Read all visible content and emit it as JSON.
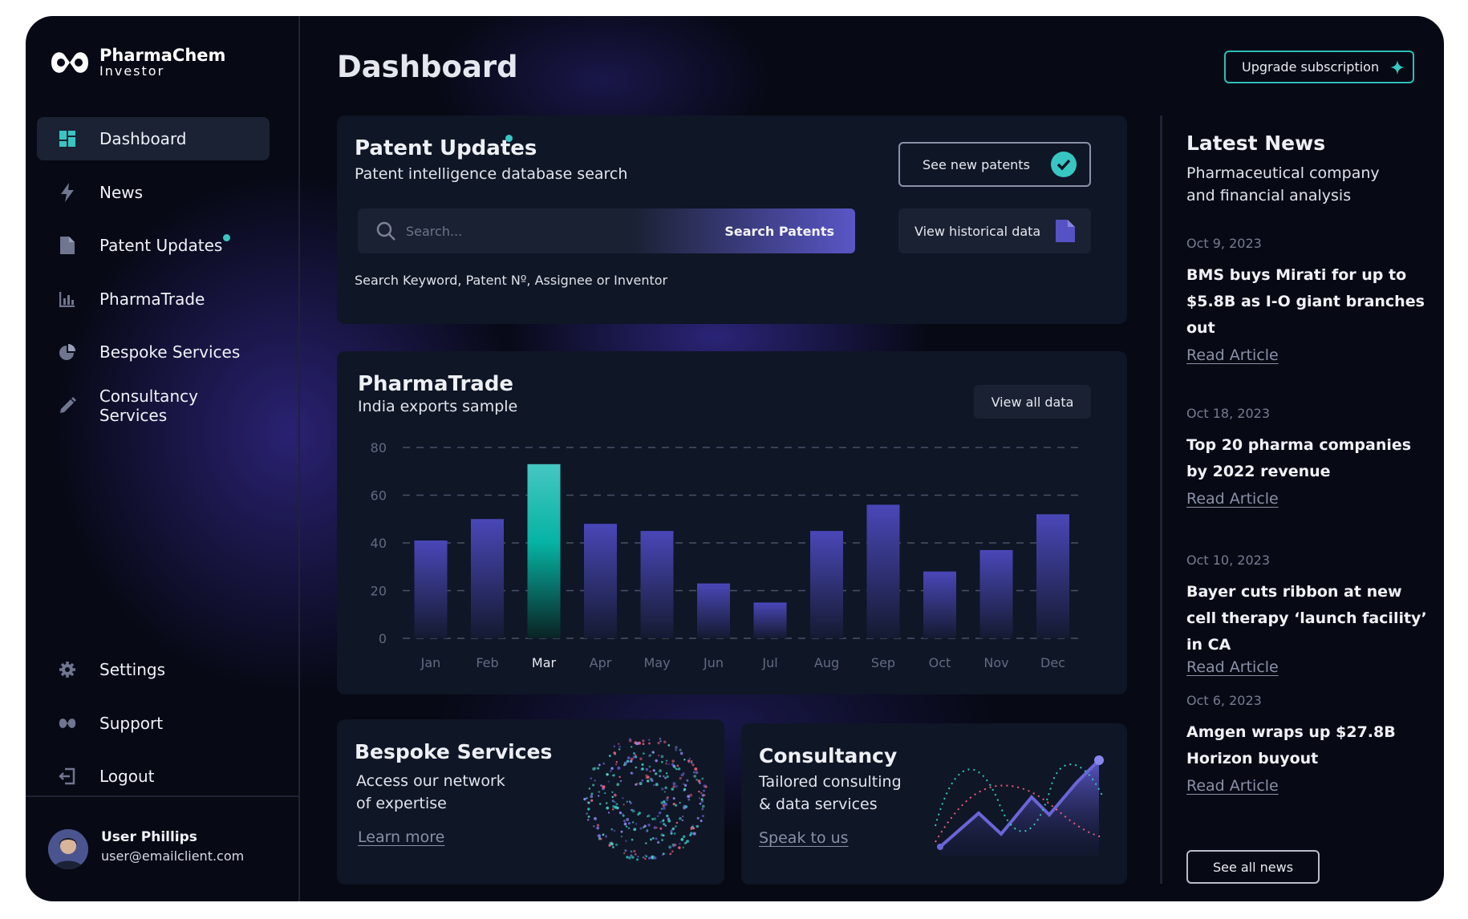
{
  "brand": {
    "name_line1": "PharmaChem",
    "name_line2": "Investor"
  },
  "sidebar": {
    "items": [
      {
        "label": "Dashboard",
        "icon": "dashboard-grid-icon",
        "active": true
      },
      {
        "label": "News",
        "icon": "lightning-icon"
      },
      {
        "label": "Patent Updates",
        "icon": "document-icon",
        "has_dot": true
      },
      {
        "label": "PharmaTrade",
        "icon": "bar-chart-icon"
      },
      {
        "label": "Bespoke Services",
        "icon": "pie-chart-icon"
      },
      {
        "label": "Consultancy Services",
        "icon": "pencil-icon"
      }
    ],
    "bottom_items": [
      {
        "label": "Settings",
        "icon": "gear-icon"
      },
      {
        "label": "Support",
        "icon": "support-icon"
      },
      {
        "label": "Logout",
        "icon": "logout-icon"
      }
    ]
  },
  "user": {
    "name": "User Phillips",
    "email": "user@emailclient.com"
  },
  "header": {
    "title": "Dashboard",
    "upgrade_label": "Upgrade subscription"
  },
  "patent": {
    "title": "Patent Updates",
    "subtitle": "Patent intelligence database search",
    "see_new_label": "See new patents",
    "search_placeholder": "Search...",
    "search_button": "Search Patents",
    "historical_label": "View historical data",
    "hint": "Search Keyword, Patent Nº, Assignee or Inventor"
  },
  "trade": {
    "title": "PharmaTrade",
    "subtitle": "India exports sample",
    "view_all_label": "View all data"
  },
  "chart_data": {
    "type": "bar",
    "categories": [
      "Jan",
      "Feb",
      "Mar",
      "Apr",
      "May",
      "Jun",
      "Jul",
      "Aug",
      "Sep",
      "Oct",
      "Nov",
      "Dec"
    ],
    "values": [
      41,
      50,
      73,
      48,
      45,
      23,
      15,
      45,
      56,
      28,
      37,
      52
    ],
    "highlight_index": 2,
    "ylim": [
      0,
      80
    ],
    "yticks": [
      0,
      20,
      40,
      60,
      80
    ],
    "grid": true,
    "colors": {
      "bar": "#4a47b8",
      "highlight": "#32c8be",
      "grid": "#4a5066",
      "tick": "#646a80"
    }
  },
  "bespoke": {
    "title": "Bespoke Services",
    "desc_line1": "Access our network",
    "desc_line2": "of expertise",
    "link": "Learn more"
  },
  "consult": {
    "title": "Consultancy",
    "desc_line1": "Tailored consulting",
    "desc_line2": "& data services",
    "link": "Speak to us"
  },
  "news": {
    "heading": "Latest News",
    "subheading": "Pharmaceutical company and financial analysis",
    "items": [
      {
        "date": "Oct 9, 2023",
        "title": "BMS buys Mirati for up to $5.8B as I-O giant branches out",
        "link": "Read Article"
      },
      {
        "date": "Oct 18, 2023",
        "title": "Top 20 pharma companies by 2022 revenue",
        "link": "Read Article"
      },
      {
        "date": "Oct 10, 2023",
        "title": "Bayer cuts ribbon at new cell therapy ‘launch facility’ in CA",
        "link": "Read Article"
      },
      {
        "date": "Oct 6, 2023",
        "title": "Amgen wraps up $27.8B Horizon buyout",
        "link": "Read Article"
      }
    ],
    "see_all_label": "See all news"
  },
  "colors": {
    "accent_teal": "#32c8be",
    "accent_indigo": "#5a56c6",
    "background": "#070915",
    "card": "#0f1626"
  }
}
